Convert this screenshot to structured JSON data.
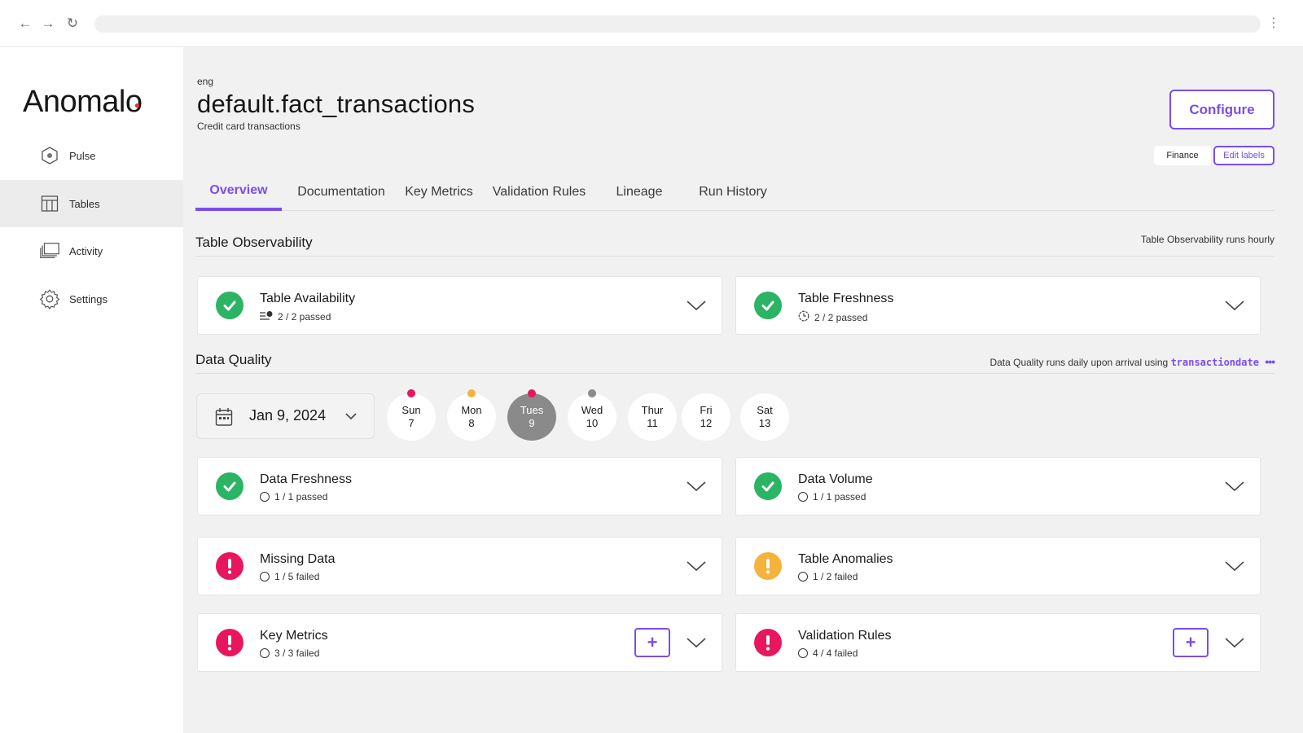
{
  "browser": {
    "back_icon": "arrow-left",
    "forward_icon": "arrow-right",
    "reload_icon": "reload",
    "menu_icon": "vertical-dots"
  },
  "app": {
    "logo": "Anomalo"
  },
  "sidebar": {
    "items": [
      {
        "label": "Pulse",
        "icon": "hexagon-icon"
      },
      {
        "label": "Tables",
        "icon": "table-icon",
        "active": true
      },
      {
        "label": "Activity",
        "icon": "stack-icon"
      },
      {
        "label": "Settings",
        "icon": "gear-icon"
      }
    ]
  },
  "header": {
    "eyebrow": "eng",
    "title": "default.fact_transactions",
    "subtitle": "Credit card transactions",
    "configure_label": "Configure",
    "labels": [
      "Finance"
    ],
    "edit_labels": "Edit labels"
  },
  "tabs": [
    "Overview",
    "Documentation",
    "Key Metrics",
    "Validation Rules",
    "Lineage",
    "Run History"
  ],
  "active_tab": "Overview",
  "observability": {
    "title": "Table Observability",
    "note": "Table Observability runs hourly",
    "cards": [
      {
        "title": "Table Availability",
        "summary": "2 / 2 passed",
        "status": "passed"
      },
      {
        "title": "Table Freshness",
        "summary": "2 / 2 passed",
        "status": "passed"
      }
    ]
  },
  "data_quality": {
    "title": "Data Quality",
    "note_prefix": "Data Quality runs daily upon arrival using",
    "note_column": "transactiondate",
    "date": "Jan 9, 2024",
    "days": [
      {
        "name": "Sun",
        "num": "7",
        "dot": "#e8175d"
      },
      {
        "name": "Mon",
        "num": "8",
        "dot": "#f5b33d"
      },
      {
        "name": "Tues",
        "num": "9",
        "dot": "#e8175d",
        "selected": true
      },
      {
        "name": "Wed",
        "num": "10",
        "dot": "#8a8a8a"
      },
      {
        "name": "Thur",
        "num": "11"
      },
      {
        "name": "Fri",
        "num": "12"
      },
      {
        "name": "Sat",
        "num": "13"
      }
    ],
    "cards": [
      {
        "title": "Data Freshness",
        "summary": "1 / 1 passed",
        "status": "passed"
      },
      {
        "title": "Data Volume",
        "summary": "1 / 1 passed",
        "status": "passed"
      },
      {
        "title": "Missing Data",
        "summary": "1 / 5 failed",
        "status": "failed"
      },
      {
        "title": "Table Anomalies",
        "summary": "1 / 2 failed",
        "status": "warning"
      },
      {
        "title": "Key Metrics",
        "summary": "3 / 3 failed",
        "status": "failed",
        "add": true
      },
      {
        "title": "Validation Rules",
        "summary": "4 / 4 failed",
        "status": "failed",
        "add": true
      }
    ]
  },
  "colors": {
    "accent": "#7b4df0",
    "passed": "#2ab464",
    "failed": "#e8175d",
    "warning": "#f5b33d"
  }
}
